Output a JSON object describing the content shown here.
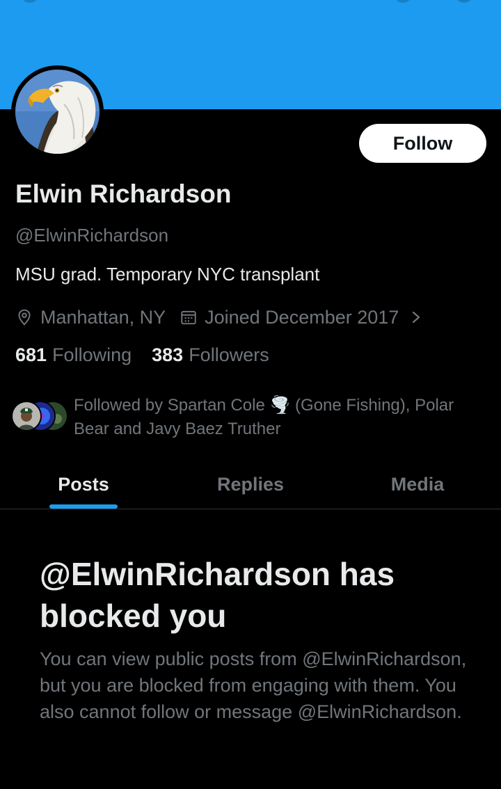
{
  "profile": {
    "name": "Elwin Richardson",
    "handle": "@ElwinRichardson",
    "bio": "MSU grad. Temporary NYC transplant",
    "location": "Manhattan, NY",
    "joined": "Joined December 2017",
    "follow_label": "Follow",
    "banner_color": "#1d9bf0"
  },
  "stats": {
    "following_count": "681",
    "following_label": "Following",
    "followers_count": "383",
    "followers_label": "Followers"
  },
  "followed_by": {
    "text": "Followed by Spartan Cole 🌪️ (Gone Fishing), Polar Bear and Javy Baez Truther"
  },
  "tabs": [
    {
      "label": "Posts",
      "active": true
    },
    {
      "label": "Replies",
      "active": false
    },
    {
      "label": "Media",
      "active": false
    }
  ],
  "blocked": {
    "title": "@ElwinRichardson has blocked you",
    "body": "You can view public posts from @ElwinRichardson, but you are blocked from engaging with them. You also cannot follow or message @ElwinRichardson."
  },
  "icons": {
    "location": "location-pin-icon",
    "calendar": "calendar-icon",
    "chevron": "chevron-right-icon",
    "avatar": "eagle-avatar"
  },
  "colors": {
    "accent": "#1d9bf0",
    "background": "#000000",
    "primary_text": "#e7e9ea",
    "secondary_text": "#71767b"
  }
}
